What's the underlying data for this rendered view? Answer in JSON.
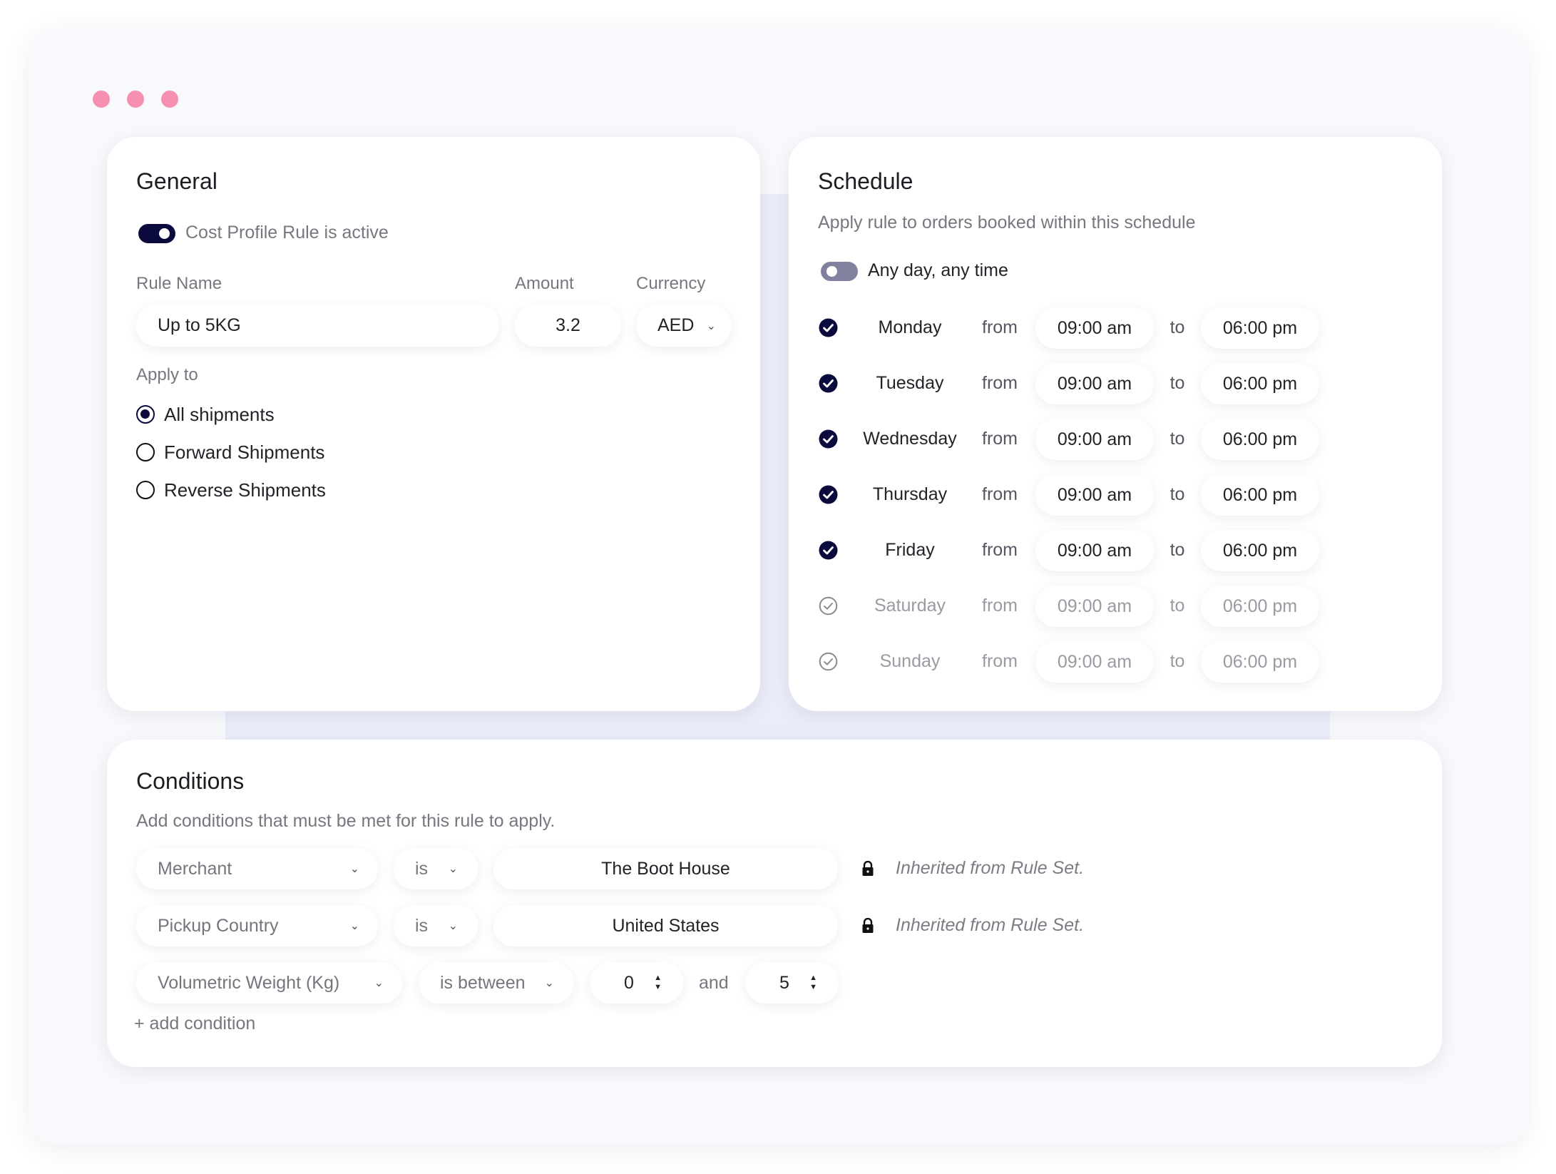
{
  "window": {
    "dots": [
      "close-dot",
      "minimize-dot",
      "maximize-dot"
    ],
    "dot_color": "#f78fb1"
  },
  "colors": {
    "accent": "#0a0a3d",
    "toggle_off": "#81819f",
    "frame_bg": "#f7f9fc",
    "backdrop": "#eaecf9"
  },
  "general": {
    "title": "General",
    "active_toggle": {
      "label": "Cost Profile Rule is active",
      "on": true
    },
    "rule_name_label": "Rule Name",
    "amount_label": "Amount",
    "currency_label": "Currency",
    "rule_name_value": "Up to 5KG",
    "amount_value": "3.2",
    "currency_value": "AED",
    "apply_to_label": "Apply to",
    "apply_to_options": [
      {
        "label": "All shipments",
        "checked": true
      },
      {
        "label": "Forward Shipments",
        "checked": false
      },
      {
        "label": "Reverse Shipments",
        "checked": false
      }
    ]
  },
  "schedule": {
    "title": "Schedule",
    "subtitle": "Apply rule to orders booked within this schedule",
    "any_time_toggle": {
      "label": "Any day, any time",
      "on": false
    },
    "from_label": "from",
    "to_label": "to",
    "days": [
      {
        "day": "Monday",
        "enabled": true,
        "from": "09:00 am",
        "to": "06:00 pm"
      },
      {
        "day": "Tuesday",
        "enabled": true,
        "from": "09:00 am",
        "to": "06:00 pm"
      },
      {
        "day": "Wednesday",
        "enabled": true,
        "from": "09:00 am",
        "to": "06:00 pm"
      },
      {
        "day": "Thursday",
        "enabled": true,
        "from": "09:00 am",
        "to": "06:00 pm"
      },
      {
        "day": "Friday",
        "enabled": true,
        "from": "09:00 am",
        "to": "06:00 pm"
      },
      {
        "day": "Saturday",
        "enabled": false,
        "from": "09:00 am",
        "to": "06:00 pm"
      },
      {
        "day": "Sunday",
        "enabled": false,
        "from": "09:00 am",
        "to": "06:00 pm"
      }
    ]
  },
  "conditions": {
    "title": "Conditions",
    "subtitle": "Add conditions that must be met for this rule to apply.",
    "rows": [
      {
        "field": "Merchant",
        "operator": "is",
        "value": "The Boot House",
        "locked": true,
        "note": "Inherited from Rule Set."
      },
      {
        "field": "Pickup Country",
        "operator": "is",
        "value": "United States",
        "locked": true,
        "note": "Inherited from Rule Set."
      }
    ],
    "range_row": {
      "field": "Volumetric Weight (Kg)",
      "operator": "is between",
      "min": "0",
      "joiner": "and",
      "max": "5"
    },
    "add_condition": "+ add condition"
  },
  "icons": {
    "chevron": "⌄",
    "step_up": "▲",
    "step_down": "▼"
  }
}
